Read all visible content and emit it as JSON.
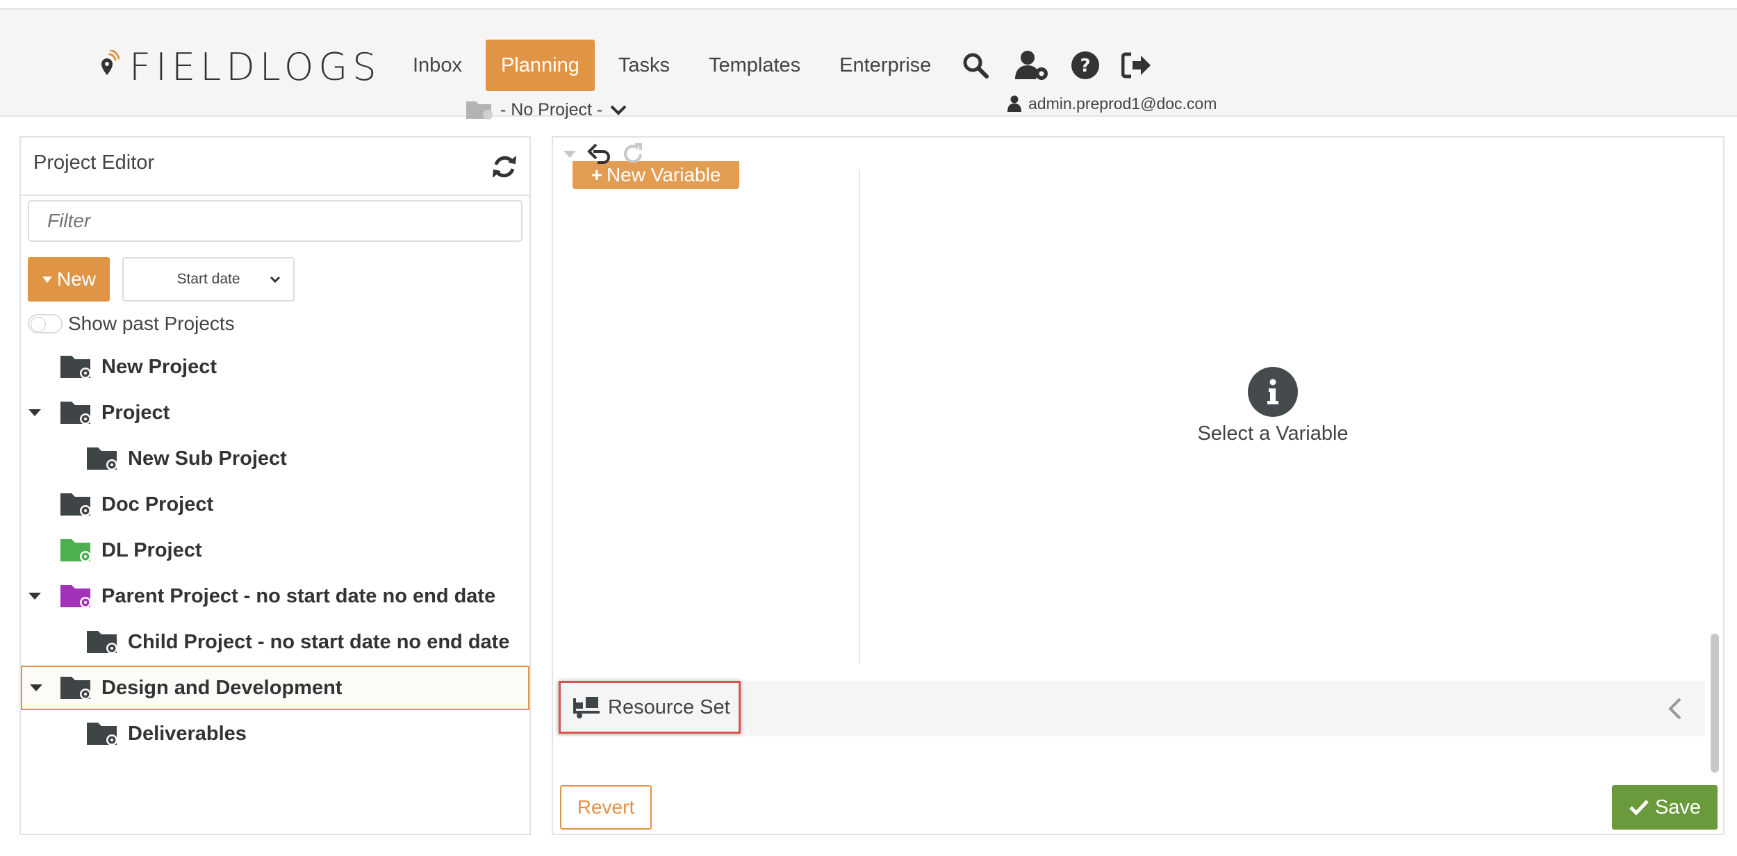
{
  "app": {
    "logo_text": "FIELDLOGS"
  },
  "nav": {
    "items": [
      {
        "label": "Inbox",
        "active": false
      },
      {
        "label": "Planning",
        "active": true
      },
      {
        "label": "Tasks",
        "active": false
      },
      {
        "label": "Templates",
        "active": false
      },
      {
        "label": "Enterprise",
        "active": false
      }
    ],
    "icons": [
      "search-icon",
      "user-settings-icon",
      "help-icon",
      "sign-out-icon"
    ],
    "project_selector": "- No Project -",
    "user_email": "admin.preprod1@doc.com"
  },
  "project_editor": {
    "title": "Project Editor",
    "filter_placeholder": "Filter",
    "new_label": "New",
    "sort_value": "Start date",
    "show_past_label": "Show past Projects",
    "show_past_on": false,
    "tree": [
      {
        "label": "New Project",
        "level": 0,
        "expanded": false,
        "color": "#3f4447"
      },
      {
        "label": "Project",
        "level": 0,
        "expanded": true,
        "color": "#3f4447"
      },
      {
        "label": "New Sub Project",
        "level": 1,
        "expanded": false,
        "color": "#3f4447"
      },
      {
        "label": "Doc Project",
        "level": 0,
        "expanded": false,
        "color": "#3f4447"
      },
      {
        "label": "DL Project",
        "level": 0,
        "expanded": false,
        "color": "#4caf50"
      },
      {
        "label": "Parent Project - no start date no end date",
        "level": 0,
        "expanded": true,
        "color": "#a232b8"
      },
      {
        "label": "Child Project - no start date no end date",
        "level": 1,
        "expanded": false,
        "color": "#3f4447"
      },
      {
        "label": "Design and Development",
        "level": 0,
        "expanded": true,
        "color": "#3f4447",
        "selected": true
      },
      {
        "label": "Deliverables",
        "level": 1,
        "expanded": false,
        "color": "#3f4447"
      }
    ]
  },
  "variables": {
    "new_variable_label": "New Variable",
    "empty_message": "Select a Variable",
    "resource_set_label": "Resource Set"
  },
  "footer": {
    "revert_label": "Revert",
    "save_label": "Save"
  },
  "colors": {
    "accent": "#e09545",
    "save": "#6a9a3c",
    "highlight": "#d9534f"
  }
}
